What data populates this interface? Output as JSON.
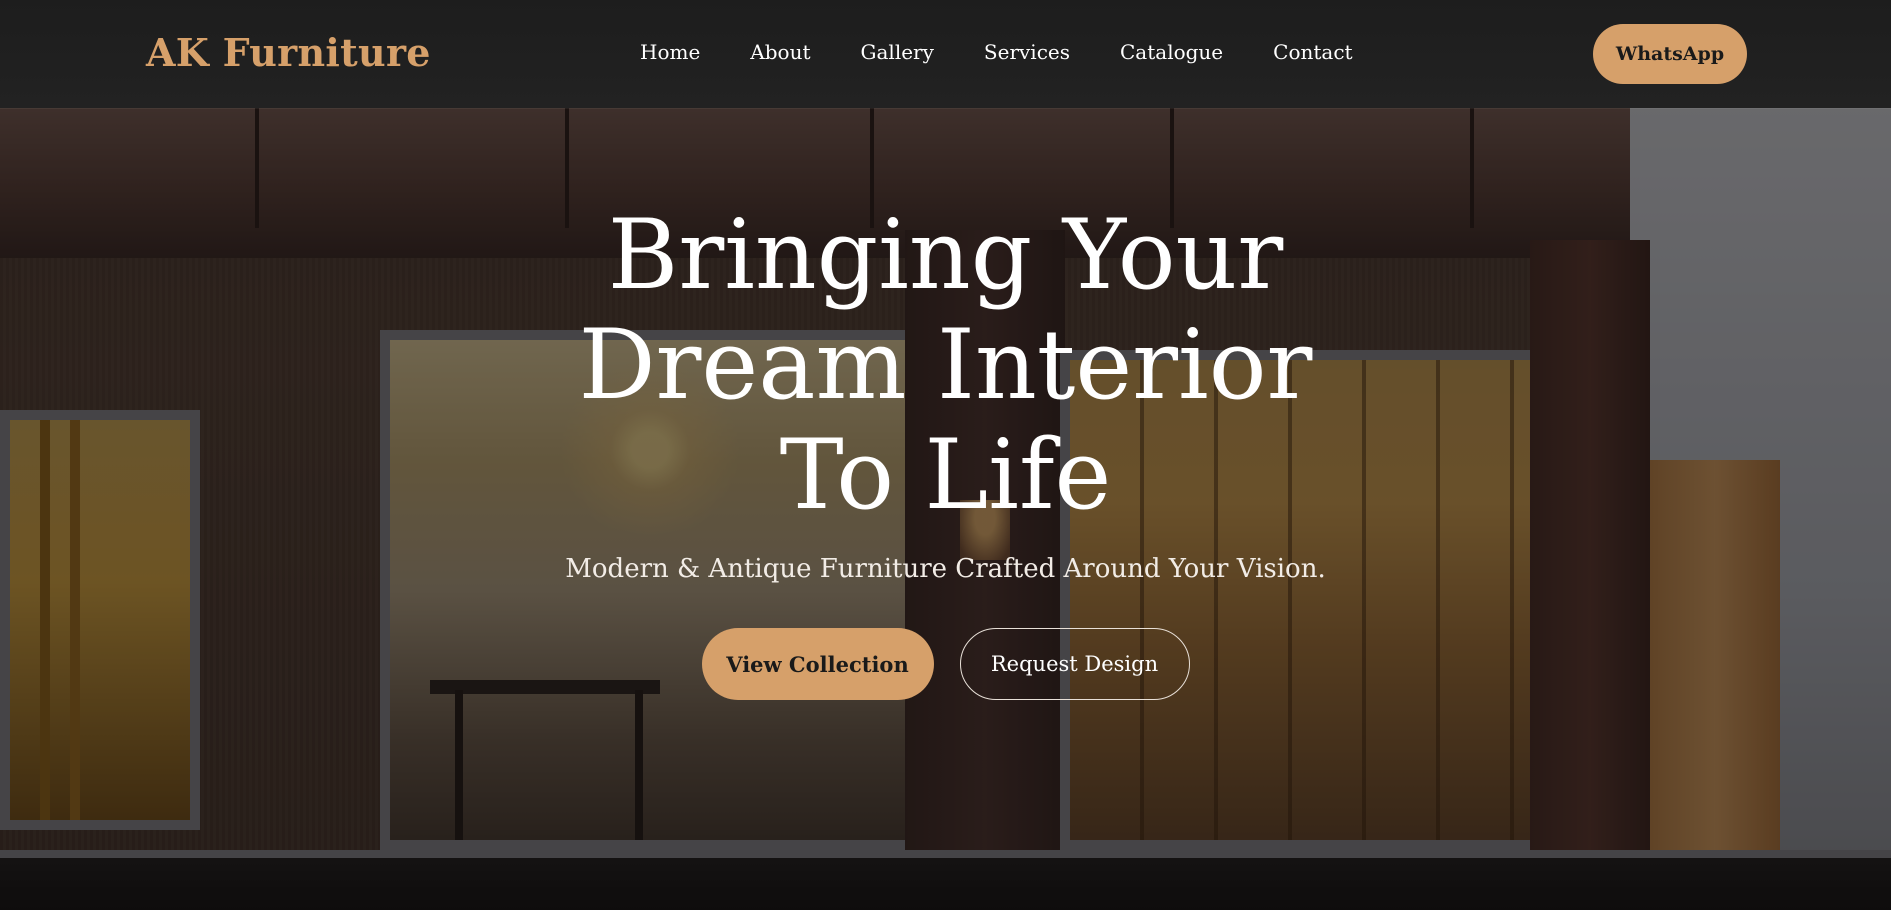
{
  "brand": {
    "name": "AK Furniture",
    "color": "#d6a06a"
  },
  "nav": {
    "links": [
      {
        "label": "Home"
      },
      {
        "label": "About"
      },
      {
        "label": "Gallery"
      },
      {
        "label": "Services"
      },
      {
        "label": "Catalogue"
      },
      {
        "label": "Contact"
      }
    ],
    "cta_label": "WhatsApp"
  },
  "hero": {
    "title_line1": "Bringing Your",
    "title_line2": "Dream Interior",
    "title_line3": "To Life",
    "subtitle": "Modern & Antique Furniture Crafted Around Your Vision.",
    "primary_button": "View Collection",
    "secondary_button": "Request Design",
    "background_image": "storefront-at-dusk"
  },
  "colors": {
    "accent": "#d6a06a",
    "nav_bg": "#1f1f1f",
    "text_light": "#ffffff"
  }
}
